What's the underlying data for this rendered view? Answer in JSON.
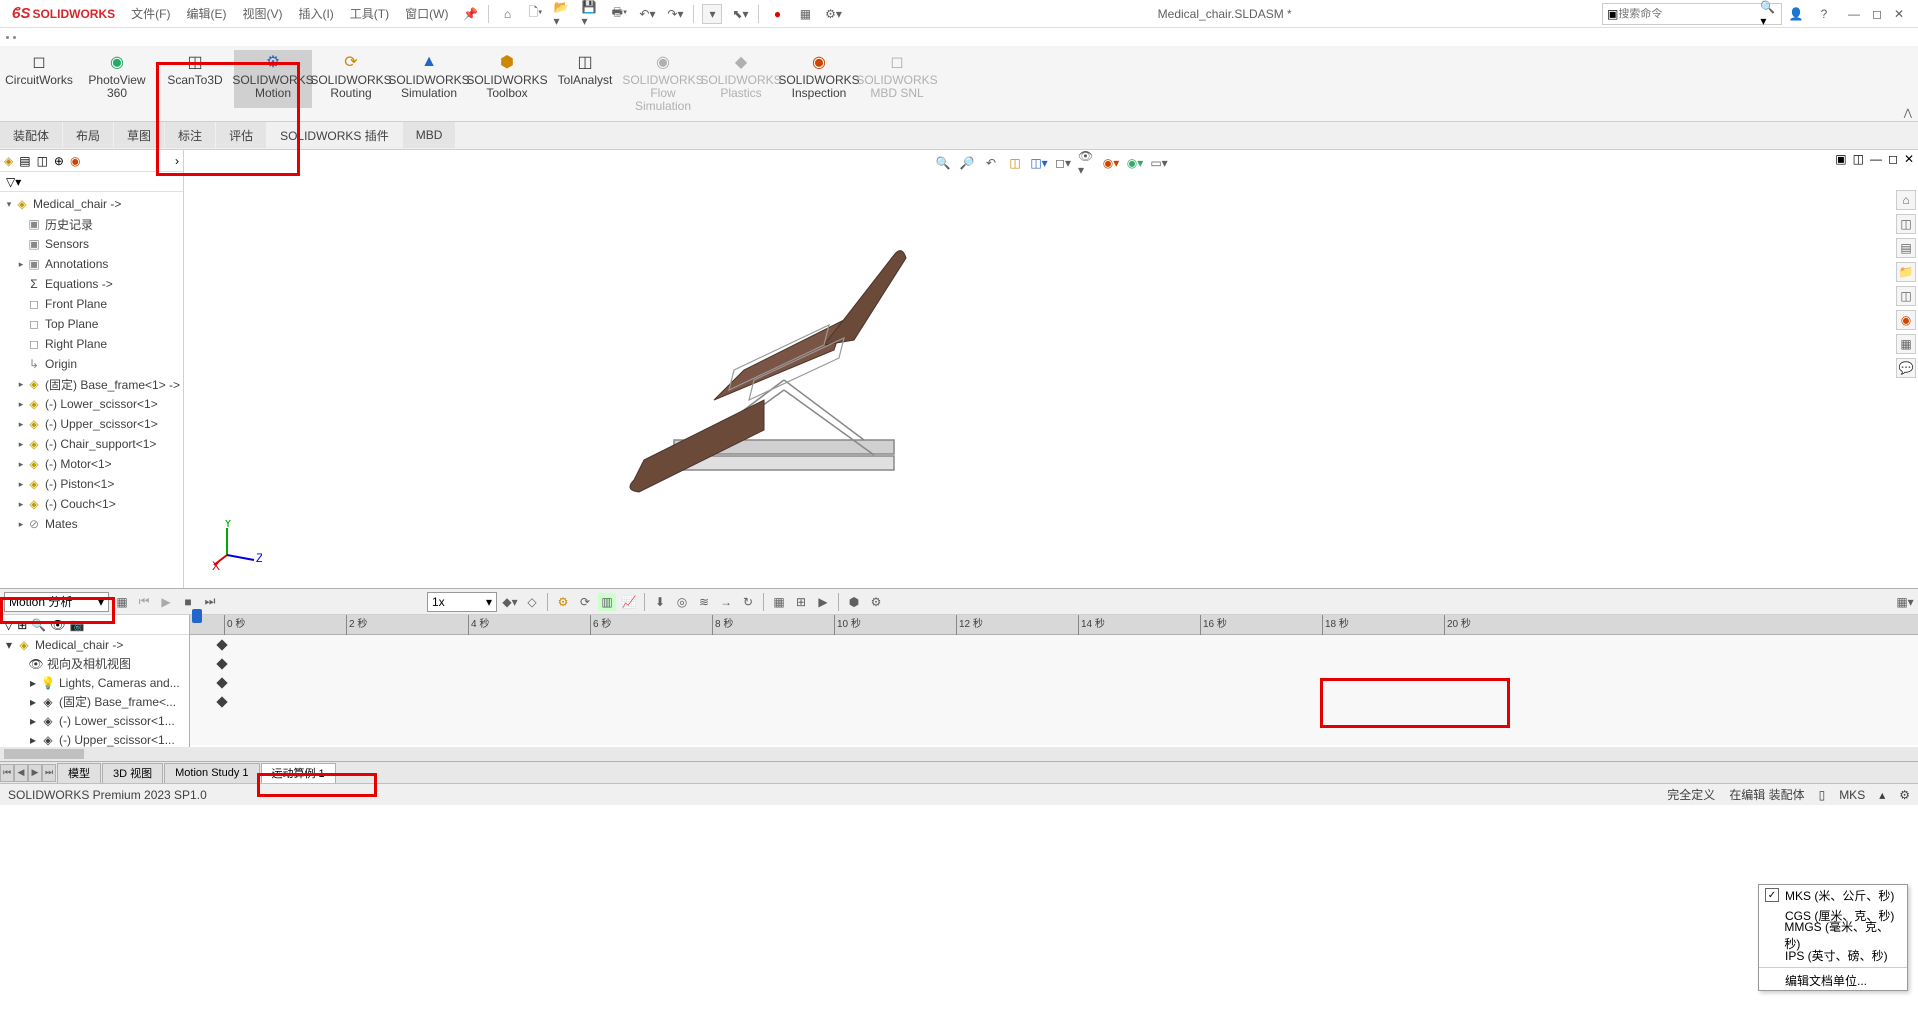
{
  "app": {
    "brand": "SOLIDWORKS",
    "doc_title": "Medical_chair.SLDASM *",
    "search_placeholder": "搜索命令"
  },
  "menu": [
    "文件(F)",
    "编辑(E)",
    "视图(V)",
    "插入(I)",
    "工具(T)",
    "窗口(W)"
  ],
  "ribbon": [
    {
      "l1": "CircuitWorks",
      "l2": ""
    },
    {
      "l1": "PhotoView",
      "l2": "360"
    },
    {
      "l1": "ScanTo3D",
      "l2": ""
    },
    {
      "l1": "SOLIDWORKS",
      "l2": "Motion",
      "active": true
    },
    {
      "l1": "SOLIDWORKS",
      "l2": "Routing"
    },
    {
      "l1": "SOLIDWORKS",
      "l2": "Simulation"
    },
    {
      "l1": "SOLIDWORKS",
      "l2": "Toolbox"
    },
    {
      "l1": "TolAnalyst",
      "l2": ""
    },
    {
      "l1": "SOLIDWORKS",
      "l2": "Flow Simulation",
      "disabled": true
    },
    {
      "l1": "SOLIDWORKS",
      "l2": "Plastics",
      "disabled": true
    },
    {
      "l1": "SOLIDWORKS",
      "l2": "Inspection"
    },
    {
      "l1": "SOLIDWORKS",
      "l2": "MBD SNL",
      "disabled": true
    }
  ],
  "tabs": [
    "装配体",
    "布局",
    "草图",
    "标注",
    "评估",
    "SOLIDWORKS 插件",
    "MBD"
  ],
  "tree": {
    "root": "Medical_chair ->",
    "items": [
      {
        "icon": "folder",
        "label": "历史记录",
        "indent": 1
      },
      {
        "icon": "folder",
        "label": "Sensors",
        "indent": 1
      },
      {
        "icon": "folder",
        "label": "Annotations",
        "indent": 1,
        "caret": true
      },
      {
        "icon": "eq",
        "label": "Equations ->",
        "indent": 1
      },
      {
        "icon": "plane",
        "label": "Front Plane",
        "indent": 1
      },
      {
        "icon": "plane",
        "label": "Top Plane",
        "indent": 1
      },
      {
        "icon": "plane",
        "label": "Right Plane",
        "indent": 1
      },
      {
        "icon": "origin",
        "label": "Origin",
        "indent": 1
      },
      {
        "icon": "part",
        "label": "(固定) Base_frame<1> ->",
        "indent": 1,
        "caret": true
      },
      {
        "icon": "part",
        "label": "(-) Lower_scissor<1>",
        "indent": 1,
        "caret": true
      },
      {
        "icon": "part",
        "label": "(-) Upper_scissor<1>",
        "indent": 1,
        "caret": true
      },
      {
        "icon": "part",
        "label": "(-) Chair_support<1>",
        "indent": 1,
        "caret": true
      },
      {
        "icon": "part",
        "label": "(-) Motor<1>",
        "indent": 1,
        "caret": true
      },
      {
        "icon": "part",
        "label": "(-) Piston<1>",
        "indent": 1,
        "caret": true
      },
      {
        "icon": "part",
        "label": "(-) Couch<1>",
        "indent": 1,
        "caret": true
      },
      {
        "icon": "mate",
        "label": "Mates",
        "indent": 1,
        "caret": true
      }
    ]
  },
  "motion": {
    "combo": "Motion 分析",
    "zoom": "1x",
    "ruler": [
      "0 秒",
      "2 秒",
      "4 秒",
      "6 秒",
      "8 秒",
      "10 秒",
      "12 秒",
      "14 秒",
      "16 秒",
      "18 秒",
      "20 秒"
    ],
    "tree_root": "Medical_chair ->",
    "tree_items": [
      "视向及相机视图",
      "Lights, Cameras and...",
      "(固定) Base_frame<...",
      "(-) Lower_scissor<1...",
      "(-) Upper_scissor<1..."
    ]
  },
  "units": {
    "items": [
      "MKS (米、公斤、秒)",
      "CGS (厘米、克、秒)",
      "MMGS (毫米、克、秒)",
      "IPS (英寸、磅、秒)"
    ],
    "edit": "编辑文档单位..."
  },
  "bottom_tabs": [
    "模型",
    "3D 视图",
    "Motion Study 1",
    "运动算例 1"
  ],
  "status": {
    "left": "SOLIDWORKS Premium 2023 SP1.0",
    "def": "完全定义",
    "mode": "在编辑 装配体",
    "units": "MKS"
  }
}
